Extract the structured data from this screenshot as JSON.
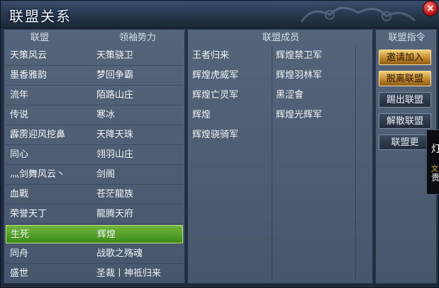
{
  "window": {
    "title": "联盟关系",
    "close_label": "×"
  },
  "headers": {
    "alliance": "联盟",
    "leader": "领袖势力",
    "members": "联盟成员",
    "commands": "联盟指令"
  },
  "alliances": [
    {
      "alliance": "天策风云",
      "leader": "天策骁卫"
    },
    {
      "alliance": "墨香雅韵",
      "leader": "梦回争霸"
    },
    {
      "alliance": "流年",
      "leader": "陌路山庄"
    },
    {
      "alliance": "传说",
      "leader": "寒冰"
    },
    {
      "alliance": "霹雳迎风挖鼻",
      "leader": "天降天珠"
    },
    {
      "alliance": "同心",
      "leader": "翎羽山庄"
    },
    {
      "alliance": "灬剑舞风云丶",
      "leader": "剑阁"
    },
    {
      "alliance": "血戰",
      "leader": "苍茫龍族"
    },
    {
      "alliance": "荣誉天丁",
      "leader": "龍腾天府"
    },
    {
      "alliance": "生死",
      "leader": "辉煌"
    },
    {
      "alliance": "同舟",
      "leader": "战歌之殇魂"
    },
    {
      "alliance": "盛世",
      "leader": "圣裁丨神祗归来"
    }
  ],
  "selected_index": 9,
  "members": [
    "王者归来",
    "辉煌禁卫军",
    "辉煌虎威军",
    "辉煌羽林军",
    "辉煌亡灵军",
    "黑涩會",
    "辉煌",
    "辉煌光辉军",
    "辉煌骁骑军"
  ],
  "commands": [
    "邀请加入",
    "脱离联盟",
    "踢出联盟",
    "解散联盟",
    "联盟更"
  ],
  "tooltip": {
    "t1": "灯",
    "t2": "文",
    "t3": "贵"
  }
}
